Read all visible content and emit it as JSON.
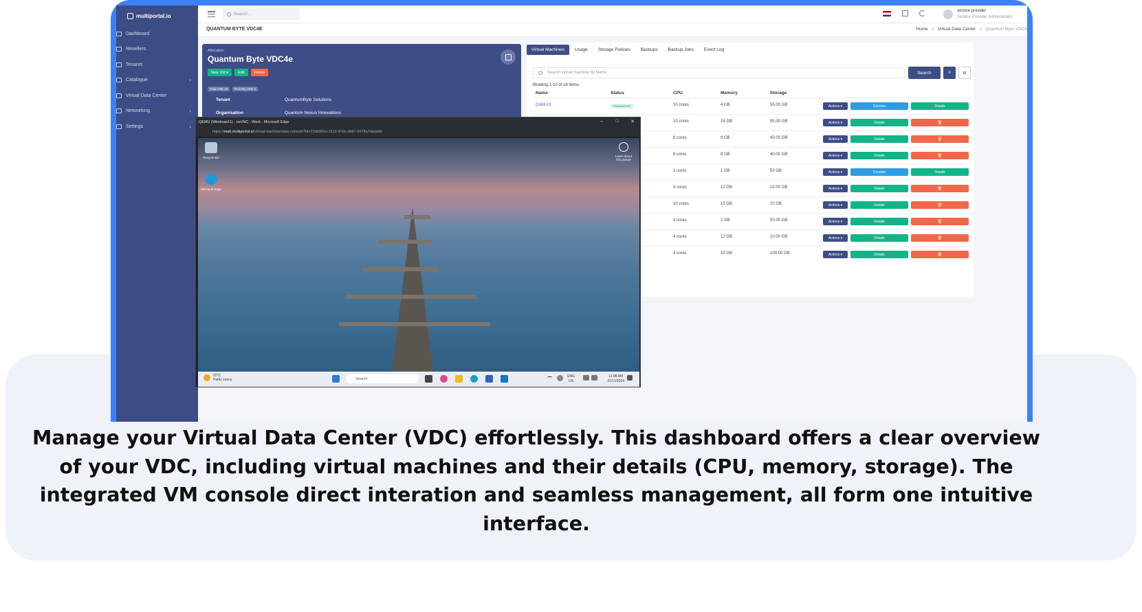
{
  "app": {
    "logo": "multiportal.io"
  },
  "sidebar": {
    "items": [
      {
        "label": "Dashboard",
        "chevron": false
      },
      {
        "label": "Resellers",
        "chevron": false
      },
      {
        "label": "Tenants",
        "chevron": false
      },
      {
        "label": "Catalogue",
        "chevron": true
      },
      {
        "label": "Virtual Data Center",
        "chevron": false
      },
      {
        "label": "Networking",
        "chevron": true
      },
      {
        "label": "Settings",
        "chevron": true
      }
    ]
  },
  "topbar": {
    "search_placeholder": "Search...",
    "user_name": "service provider",
    "user_role": "Service Provider Administrator"
  },
  "header": {
    "page_title": "QUANTUM BYTE VDC4E",
    "breadcrumbs": [
      "Home",
      "Virtual Data Center",
      "Quantum Byte VDC4"
    ]
  },
  "vdc_card": {
    "allocation_label": "Allocation",
    "name": "Quantum Byte VDC4e",
    "buttons": {
      "new_vm": "New VM ▾",
      "edit": "Edit",
      "delete": "Delete"
    },
    "badges": [
      "Total VMs 18",
      "Running VMs 3"
    ],
    "tenant_label": "Tenant",
    "tenant_value": "QuantumByte Solutions",
    "org_label": "Organisation",
    "org_value": "Quantum Nexus Innovations"
  },
  "vm_panel": {
    "tabs": [
      "Virtual Machines",
      "Usage",
      "Storage Policies",
      "Backups",
      "Backup Jobs",
      "Event Log"
    ],
    "search_placeholder": "Search virtual machine by Name",
    "search_button": "Search",
    "showing": "Showing 1-10 of 18 items.",
    "columns": [
      "Name",
      "Status",
      "CPU",
      "Memory",
      "Storage"
    ],
    "actions_label": "Actions ▾",
    "console_label": "Console",
    "details_label": "Details",
    "delete_icon": "🗑",
    "rows": [
      {
        "name": "Qubit-01",
        "status": "Powered On",
        "cpu": "10 cores",
        "memory": "4 GB",
        "storage": "55.00 GB",
        "b1": "Console",
        "b1c": "#2f9ee0",
        "b2": "Details",
        "b2c": "#14b38a"
      },
      {
        "name": "",
        "status": "",
        "cpu": "10 cores",
        "memory": "16 GB",
        "storage": "55.00 GB",
        "b1": "Details",
        "b1c": "#14b38a",
        "b2": "🗑",
        "b2c": "#f16749"
      },
      {
        "name": "",
        "status": "",
        "cpu": "8 cores",
        "memory": "8 GB",
        "storage": "40.00 GB",
        "b1": "Details",
        "b1c": "#14b38a",
        "b2": "🗑",
        "b2c": "#f16749"
      },
      {
        "name": "",
        "status": "",
        "cpu": "8 cores",
        "memory": "8 GB",
        "storage": "40.00 GB",
        "b1": "Details",
        "b1c": "#14b38a",
        "b2": "🗑",
        "b2c": "#f16749"
      },
      {
        "name": "",
        "status": "",
        "cpu": "1 cores",
        "memory": "1 GB",
        "storage": "50 GB",
        "b1": "Console",
        "b1c": "#2f9ee0",
        "b2": "Details",
        "b2c": "#14b38a"
      },
      {
        "name": "",
        "status": "",
        "cpu": "8 cores",
        "memory": "12 GB",
        "storage": "10.00 GB",
        "b1": "Details",
        "b1c": "#14b38a",
        "b2": "🗑",
        "b2c": "#f16749"
      },
      {
        "name": "",
        "status": "",
        "cpu": "10 cores",
        "memory": "10 GB",
        "storage": "10 GB",
        "b1": "Details",
        "b1c": "#14b38a",
        "b2": "🗑",
        "b2c": "#f16749"
      },
      {
        "name": "",
        "status": "",
        "cpu": "4 cores",
        "memory": "2 GB",
        "storage": "50.00 GB",
        "b1": "Details",
        "b1c": "#14b38a",
        "b2": "🗑",
        "b2c": "#f16749"
      },
      {
        "name": "",
        "status": "",
        "cpu": "4 cores",
        "memory": "12 GB",
        "storage": "10.00 GB",
        "b1": "Details",
        "b1c": "#14b38a",
        "b2": "🗑",
        "b2c": "#f16749"
      },
      {
        "name": "",
        "status": "",
        "cpu": "4 cores",
        "memory": "10 GB",
        "storage": "100.00 GB",
        "b1": "Details",
        "b1c": "#14b38a",
        "b2": "🗑",
        "b2c": "#f16749"
      }
    ]
  },
  "console": {
    "title": "QEMU (Windows11) - noVNC - Work - Microsoft Edge",
    "url_prefix": "https://",
    "url_host": "matt.multiportal.io",
    "url_path": "/virtual-machine/view-console?id=23db991a-3113-47dc-ab57-2678a7daaabb",
    "desktop_icons": [
      "Recycle Bin",
      "Microsoft Edge",
      "Learn about this picture"
    ],
    "weather_temp": "22°C",
    "weather_desc": "Partly sunny",
    "taskbar_search": "Search",
    "lang": "ENG",
    "region": "US",
    "time": "11:08 AM",
    "date": "21/11/2024"
  },
  "caption": "Manage your Virtual Data Center (VDC) effortlessly. This dashboard offers a clear overview of your VDC, including virtual machines and their details (CPU, memory, storage). The integrated VM console direct interation and seamless management, all form one intuitive interface.",
  "colors": {
    "brand": "#3b82f6",
    "sidebar": "#3c4c84",
    "primary": "#3f4d86",
    "success": "#14b38a",
    "info": "#2f9ee0",
    "danger": "#f16749"
  }
}
